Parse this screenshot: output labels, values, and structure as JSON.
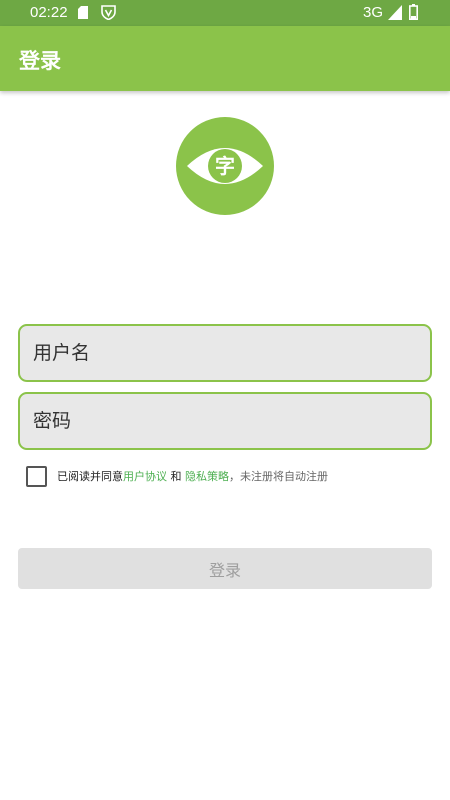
{
  "status_bar": {
    "time": "02:22",
    "network": "3G",
    "icons": [
      "sd-card-icon",
      "vpn-shield-icon",
      "signal-icon",
      "battery-icon"
    ]
  },
  "app_bar": {
    "title": "登录"
  },
  "logo": {
    "glyph": "字",
    "icon": "eye-logo-icon",
    "color": "#8bc34a"
  },
  "form": {
    "username_placeholder": "用户名",
    "password_placeholder": "密码"
  },
  "agreement": {
    "prefix": "已阅读并同意",
    "user_agreement": "用户协议",
    "and": " 和 ",
    "privacy_policy": "隐私策略",
    "suffix": "，未注册将自动注册"
  },
  "login_button": {
    "label": "登录"
  },
  "colors": {
    "status_bar": "#6ea844",
    "accent": "#8bc34a",
    "link": "#4caf50",
    "button_disabled_bg": "#e0e0e0",
    "button_disabled_text": "#9e9e9e"
  }
}
